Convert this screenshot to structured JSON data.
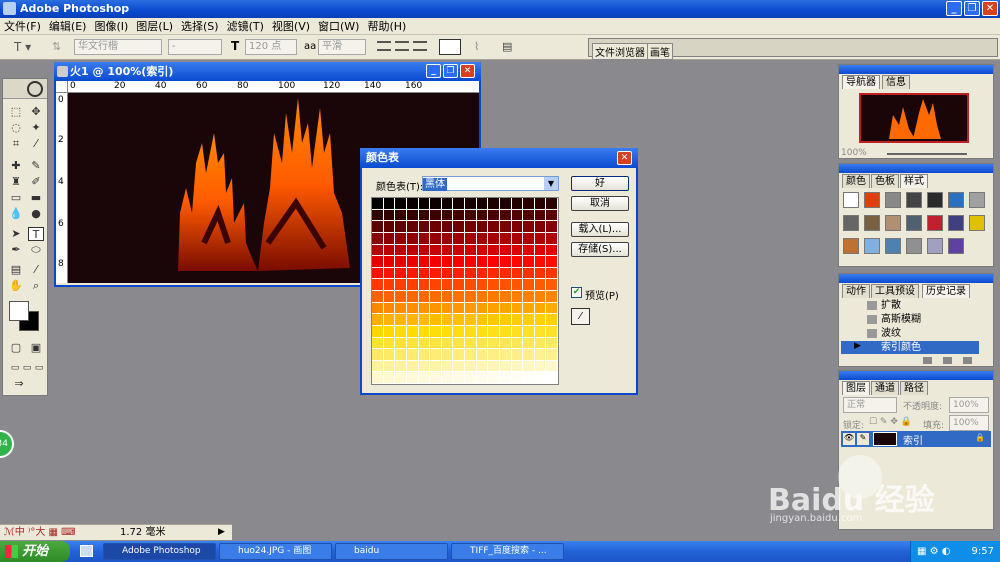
{
  "app": {
    "title": "Adobe Photoshop"
  },
  "menu": [
    "文件(F)",
    "编辑(E)",
    "图像(I)",
    "图层(L)",
    "选择(S)",
    "滤镜(T)",
    "视图(V)",
    "窗口(W)",
    "帮助(H)"
  ],
  "options": {
    "font_family": "华文行楷",
    "font_size": "120 点",
    "antialias": "平滑",
    "wells": [
      "文件浏览器",
      "画笔"
    ]
  },
  "document": {
    "title": "火1 @ 100%(索引)",
    "ruler_ticks": [
      "0",
      "20",
      "40",
      "60",
      "80",
      "100",
      "120",
      "140",
      "160"
    ],
    "v_ticks": [
      "0",
      "2",
      "4",
      "6",
      "8"
    ]
  },
  "dialog": {
    "title": "颜色表",
    "table_label": "颜色表(T):",
    "table_value": "黑体",
    "buttons": {
      "ok": "好",
      "cancel": "取消",
      "load": "载入(L)...",
      "save": "存储(S)..."
    },
    "preview_label": "预览(P)",
    "preview_checked": true
  },
  "navigator": {
    "tabs": [
      "导航器",
      "信息"
    ],
    "zoom": "100%"
  },
  "swatches": {
    "tabs": [
      "颜色",
      "色板",
      "样式"
    ]
  },
  "history": {
    "tabs": [
      "动作",
      "工具预设",
      "历史记录"
    ],
    "items": [
      "扩散",
      "高斯模糊",
      "波纹",
      "索引颜色"
    ],
    "selected_index": 3
  },
  "layers": {
    "tabs": [
      "图层",
      "通道",
      "路径"
    ],
    "blend_mode": "正常",
    "opacity_label": "不透明度:",
    "opacity": "100%",
    "lock_label": "锁定:",
    "fill_label": "填充:",
    "fill": "100%",
    "layer_name": "索引"
  },
  "status": {
    "size": "1.72 毫米"
  },
  "taskbar": {
    "start": "开始",
    "tasks": [
      "Adobe Photoshop",
      "huo24.JPG - 画图",
      "baidu",
      "TIFF_百度搜索 - ..."
    ],
    "clock": "9:57"
  },
  "watermark": {
    "text": "Baidu 经验",
    "url": "jingyan.baidu.com"
  },
  "badge": "34"
}
